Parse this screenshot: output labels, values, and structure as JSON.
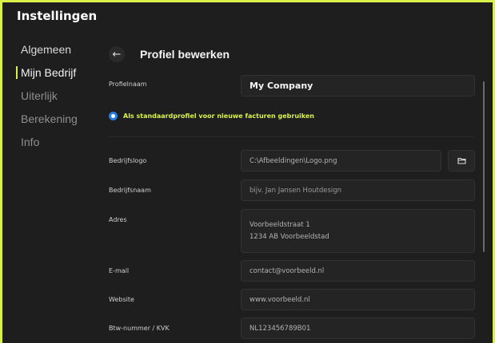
{
  "app": {
    "title": "Instellingen"
  },
  "sidebar": {
    "items": [
      {
        "label": "Algemeen"
      },
      {
        "label": "Mijn Bedrijf"
      },
      {
        "label": "Uiterlijk"
      },
      {
        "label": "Berekening"
      },
      {
        "label": "Info"
      }
    ]
  },
  "header": {
    "back_icon": "arrow-left-icon",
    "title": "Profiel bewerken"
  },
  "form": {
    "profile_name": {
      "label": "Profielnaam",
      "value": "My Company"
    },
    "default_option": {
      "label": "Als standaardprofiel voor nieuwe facturen gebruiken",
      "selected": true
    },
    "logo": {
      "label": "Bedrijfslogo",
      "value": "C:\\Afbeeldingen\\Logo.png",
      "browse_icon": "folder-icon"
    },
    "company_name": {
      "label": "Bedrijfsnaam",
      "placeholder": "bijv. Jan Jansen Houtdesign"
    },
    "address": {
      "label": "Adres",
      "line1": "Voorbeeldstraat 1",
      "line2": "1234 AB Voorbeeldstad"
    },
    "email": {
      "label": "E-mail",
      "value": "contact@voorbeeld.nl"
    },
    "website": {
      "label": "Website",
      "value": "www.voorbeeld.nl"
    },
    "vat": {
      "label": "Btw-nummer / KVK",
      "value": "NL123456789B01"
    }
  },
  "colors": {
    "accent": "#d8f24a",
    "radio": "#2a7de1",
    "background": "#1e1e1e"
  }
}
